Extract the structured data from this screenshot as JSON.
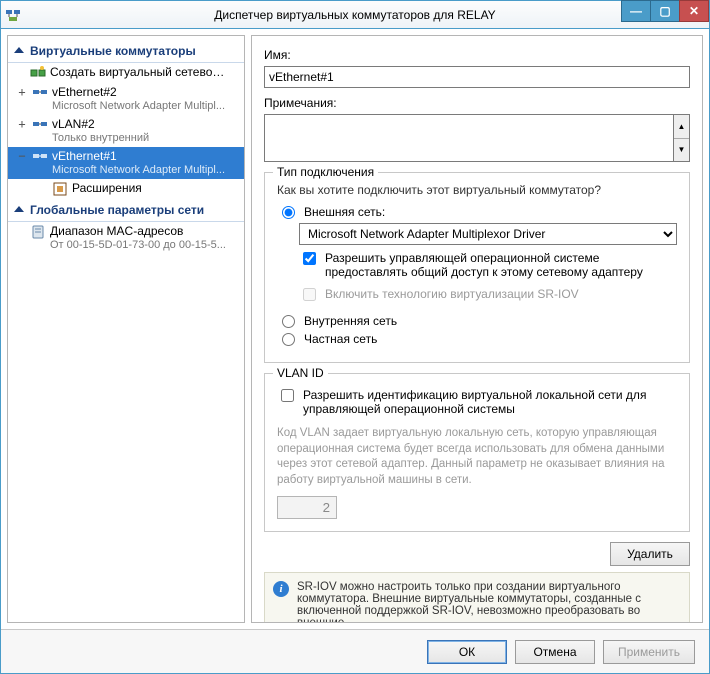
{
  "window": {
    "title": "Диспетчер виртуальных коммутаторов для RELAY"
  },
  "left": {
    "section1": "Виртуальные коммутаторы",
    "create": "Создать виртуальный сетевой к...",
    "items": [
      {
        "exp": "+",
        "label": "vEthernet#2",
        "sub": "Microsoft Network Adapter Multipl..."
      },
      {
        "exp": "+",
        "label": "vLAN#2",
        "sub": "Только внутренний"
      },
      {
        "exp": "−",
        "label": "vEthernet#1",
        "sub": "Microsoft Network Adapter Multipl...",
        "selected": true
      }
    ],
    "child": "Расширения",
    "section2": "Глобальные параметры сети",
    "mac": {
      "label": "Диапазон MAC-адресов",
      "sub": "От 00-15-5D-01-73-00 до 00-15-5..."
    }
  },
  "right": {
    "name_label": "Имя:",
    "name_value": "vEthernet#1",
    "notes_label": "Примечания:",
    "notes_value": "",
    "conn": {
      "legend": "Тип подключения",
      "question": "Как вы хотите подключить этот виртуальный коммутатор?",
      "external": "Внешняя сеть:",
      "adapter": "Microsoft Network Adapter Multiplexor Driver",
      "allow_mgmt": "Разрешить управляющей операционной системе предоставлять общий доступ к этому сетевому адаптеру",
      "sriov": "Включить технологию виртуализации SR-IOV",
      "internal": "Внутренняя сеть",
      "private": "Частная сеть"
    },
    "vlan": {
      "legend": "VLAN ID",
      "enable": "Разрешить идентификацию виртуальной локальной сети для управляющей операционной системы",
      "help": "Код VLAN задает виртуальную локальную сеть, которую управляющая операционная система будет всегда использовать для обмена данными через этот сетевой адаптер. Данный параметр не оказывает влияния на работу виртуальной машины в сети.",
      "value": "2"
    },
    "delete": "Удалить",
    "info": "SR-IOV можно настроить только при создании виртуального коммутатора. Внешние виртуальные коммутаторы, созданные с включенной поддержкой SR-IOV, невозможно преобразовать во внешние"
  },
  "footer": {
    "ok": "ОК",
    "cancel": "Отмена",
    "apply": "Применить"
  }
}
